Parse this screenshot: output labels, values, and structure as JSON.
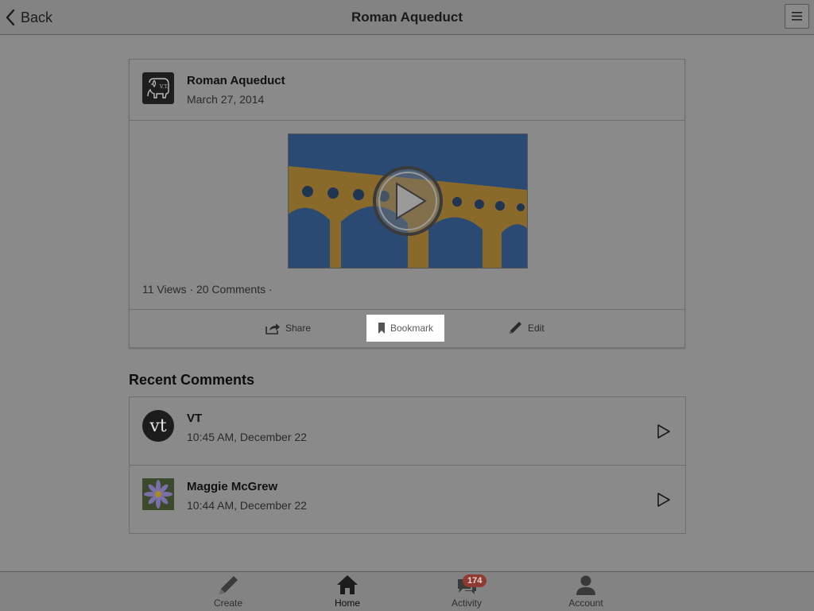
{
  "header": {
    "back_label": "Back",
    "title": "Roman Aqueduct",
    "menu_icon": "hamburger-menu-icon"
  },
  "post": {
    "title": "Roman Aqueduct",
    "date": "March 27, 2014",
    "avatar_icon": "vt-elephant-logo",
    "stats": "11 Views · 20 Comments ·",
    "video_thumbnail": "roman-aqueduct-thumbnail",
    "actions": {
      "share": "Share",
      "bookmark": "Bookmark",
      "edit": "Edit"
    }
  },
  "recent_comments": {
    "title": "Recent Comments",
    "items": [
      {
        "name": "VT",
        "time": "10:45 AM, December 22",
        "avatar": "vt-logo",
        "avatar_text": "vt"
      },
      {
        "name": "Maggie McGrew",
        "time": "10:44 AM, December 22",
        "avatar": "purple-flower-photo"
      }
    ]
  },
  "tabbar": {
    "create": "Create",
    "home": "Home",
    "activity": "Activity",
    "activity_badge": "174",
    "account": "Account",
    "active_tab": "home"
  },
  "colors": {
    "overlay_bg": "#8a8a8a",
    "sky": "#2b4a73",
    "stone": "#8a6a2a",
    "badge": "#8e3a32"
  }
}
